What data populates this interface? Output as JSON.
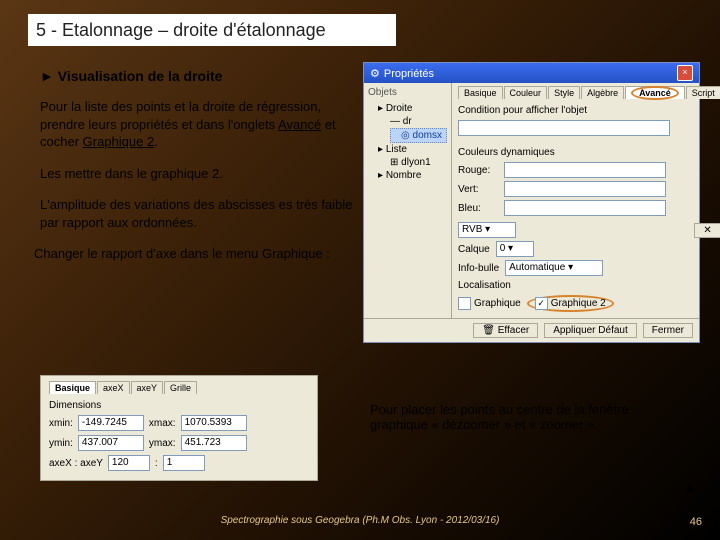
{
  "title": "5 - Etalonnage – droite d'étalonnage",
  "subtitle": "► Visualisation de la droite",
  "p1a": "Pour la liste des points et la droite de régression,  prendre leurs propriétés et dans l'onglets ",
  "p1b": "Avancé",
  "p1c": " et cocher ",
  "p1d": "Graphique 2",
  "p1e": ".",
  "p2": "Les mettre dans le graphique 2.",
  "p3": "L'amplitude des variations des abscisses es très faible par rapport aux ordonnées.",
  "p4": "Changer le rapport d'axe dans le menu Graphique :",
  "dlg": {
    "title": "Propriétés",
    "tree_lbl": "Objets",
    "n1": "Droite",
    "n2": "dr",
    "n3": "domsx",
    "n4": "Liste",
    "n5": "dlyon1",
    "n6": "Nombre",
    "tabs": {
      "t1": "Basique",
      "t2": "Couleur",
      "t3": "Style",
      "t4": "Algèbre",
      "t5": "Avancé",
      "t6": "Script"
    },
    "cond": "Condition pour afficher l'objet",
    "dyn": "Couleurs dynamiques",
    "r": "Rouge:",
    "v": "Vert:",
    "b": "Bleu:",
    "rvb": "RVB",
    "calq": "Calque",
    "calqv": "0",
    "info": "Info-bulle",
    "infov": "Automatique",
    "loc": "Localisation",
    "g1": "Graphique",
    "g2": "Graphique 2",
    "eff": "Effacer",
    "def": "Appliquer Défaut",
    "clo": "Fermer"
  },
  "p2dlg": {
    "t1": "Basique",
    "t2": "axeX",
    "t3": "axeY",
    "t4": "Grille",
    "dim": "Dimensions",
    "xmin": "xmin:",
    "xminv": "-149.7245",
    "xmax": "xmax:",
    "xmaxv": "1070.5393",
    "ymin": "ymin:",
    "yminv": "437.007",
    "ymax": "ymax:",
    "ymaxv": "451.723",
    "axe": "axeX : axeY",
    "rx": "120",
    "ry": "1"
  },
  "bottom": "Pour placer les points au centre de la fenêtre graphique « dézoomer » et « zoomer ».",
  "arrow": "►",
  "footer": "Spectrographie sous Geogebra (Ph.M Obs. Lyon - 2012/03/16)",
  "page": "46"
}
